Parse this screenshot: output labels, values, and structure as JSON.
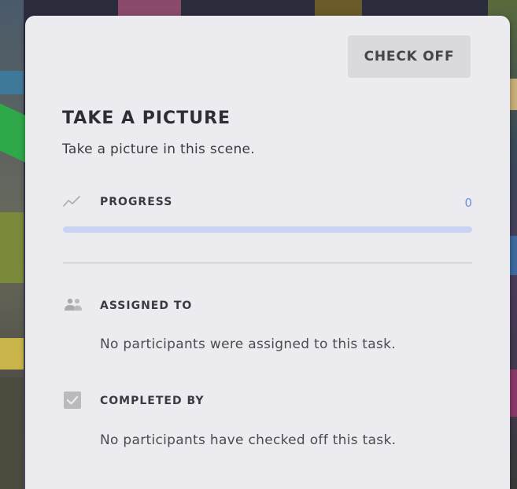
{
  "task": {
    "check_off_label": "CHECK OFF",
    "title": "TAKE A PICTURE",
    "description": "Take a picture in this scene."
  },
  "progress": {
    "label": "PROGRESS",
    "value": "0",
    "fraction": 0,
    "icon": "trend-line-icon"
  },
  "assigned": {
    "label": "ASSIGNED TO",
    "text": "No participants were assigned to this task.",
    "icon": "people-icon"
  },
  "completed": {
    "label": "COMPLETED BY",
    "text": "No participants have checked off this task.",
    "icon": "checkbox-icon"
  },
  "colors": {
    "accent": "#6a8ee8",
    "panel": "#ececf0",
    "button_bg": "#dadade"
  }
}
